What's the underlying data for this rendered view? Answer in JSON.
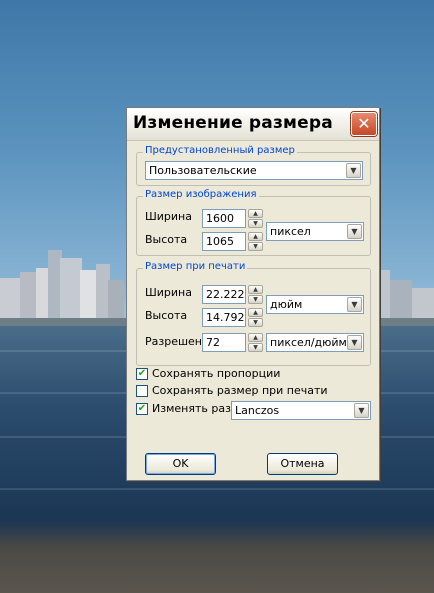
{
  "dialog": {
    "title": "Изменение размера",
    "preset": {
      "legend": "Предустановленный размер",
      "selected": "Пользовательские"
    },
    "image_size": {
      "legend": "Размер изображения",
      "width_label": "Ширина",
      "width_value": "1600",
      "height_label": "Высота",
      "height_value": "1065",
      "unit": "пиксел"
    },
    "print_size": {
      "legend": "Размер при печати",
      "width_label": "Ширина",
      "width_value": "22.222",
      "height_label": "Высота",
      "height_value": "14.792",
      "size_unit": "дюйм",
      "resolution_label": "Разрешение",
      "resolution_value": "72",
      "resolution_unit": "пиксел/дюйм"
    },
    "options": {
      "keep_proportions": {
        "label": "Сохранять пропорции",
        "checked": true
      },
      "keep_print_size": {
        "label": "Сохранять размер при печати",
        "checked": false
      },
      "resample": {
        "label": "Изменять разрешение",
        "checked": true,
        "method": "Lanczos"
      }
    },
    "buttons": {
      "ok": "OK",
      "cancel": "Отмена"
    }
  }
}
